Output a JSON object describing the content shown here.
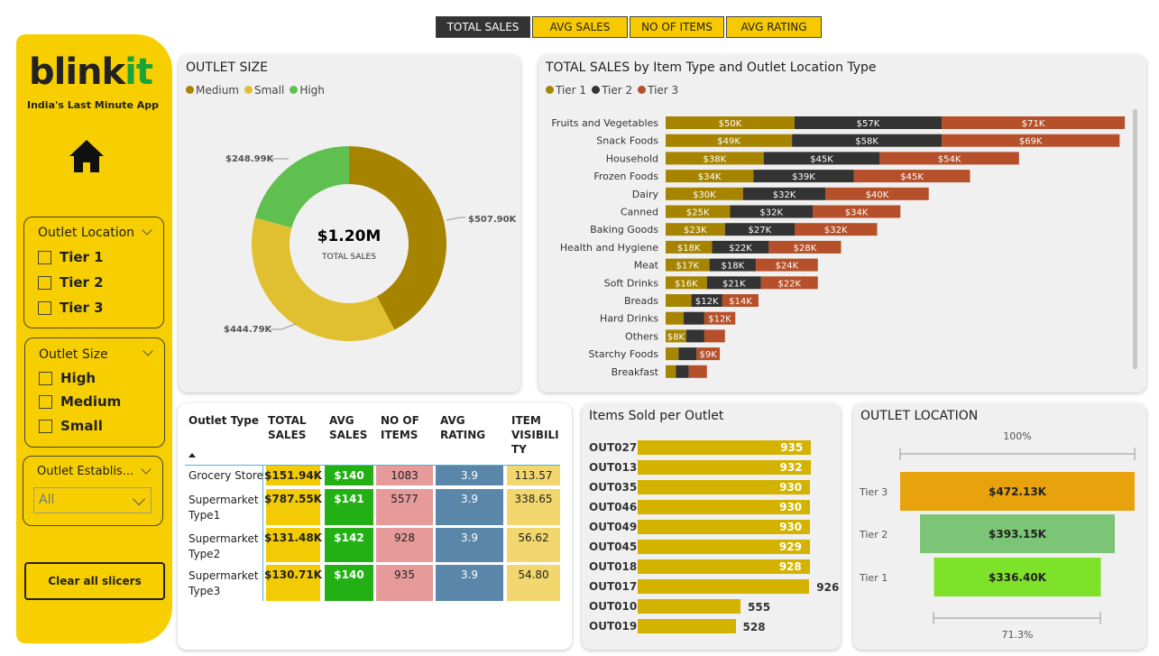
{
  "tabs": [
    {
      "label": "TOTAL SALES",
      "active": true
    },
    {
      "label": "AVG SALES",
      "active": false
    },
    {
      "label": "NO OF ITEMS",
      "active": false
    },
    {
      "label": "AVG RATING",
      "active": false
    }
  ],
  "sidebar": {
    "logo_part1": "blink",
    "logo_part2": "it",
    "tagline": "India's Last Minute App",
    "home_icon": "home-icon",
    "outlet_location": {
      "title": "Outlet Location",
      "options": [
        "Tier 1",
        "Tier 2",
        "Tier 3"
      ]
    },
    "outlet_size": {
      "title": "Outlet Size",
      "options": [
        "High",
        "Medium",
        "Small"
      ]
    },
    "outlet_establishment": {
      "title": "Outlet Establis...",
      "value": "All"
    },
    "clear_button": "Clear all slicers"
  },
  "outlet_size_chart": {
    "title": "OUTLET SIZE",
    "center_value": "$1.20M",
    "center_label": "TOTAL SALES",
    "legend": [
      "Medium",
      "Small",
      "High"
    ],
    "colors": {
      "Medium": "#A68400",
      "Small": "#E0C030",
      "High": "#5FBF4F"
    },
    "labels": [
      "$507.90K",
      "$444.79K",
      "$248.99K"
    ]
  },
  "item_type_chart": {
    "title": "TOTAL SALES by Item Type and Outlet Location Type",
    "legend": [
      "Tier 1",
      "Tier 2",
      "Tier 3"
    ],
    "colors": {
      "Tier 1": "#A68400",
      "Tier 2": "#333333",
      "Tier 3": "#B5502A"
    }
  },
  "chart_data": [
    {
      "type": "pie",
      "title": "OUTLET SIZE",
      "categories": [
        "Medium",
        "Small",
        "High"
      ],
      "values": [
        507.9,
        444.79,
        248.99
      ],
      "unit": "$K"
    },
    {
      "type": "bar",
      "orientation": "horizontal",
      "stacked": true,
      "title": "TOTAL SALES by Item Type and Outlet Location Type",
      "categories": [
        "Fruits and Vegetables",
        "Snack Foods",
        "Household",
        "Frozen Foods",
        "Dairy",
        "Canned",
        "Baking Goods",
        "Health and Hygiene",
        "Meat",
        "Soft Drinks",
        "Breads",
        "Hard Drinks",
        "Others",
        "Starchy Foods",
        "Breakfast"
      ],
      "series": [
        {
          "name": "Tier 1",
          "values": [
            50,
            49,
            38,
            34,
            30,
            25,
            23,
            18,
            17,
            16,
            10,
            7,
            8,
            5,
            4
          ],
          "labels": [
            "$50K",
            "$49K",
            "$38K",
            "$34K",
            "$30K",
            "$25K",
            "$23K",
            "$18K",
            "$17K",
            "$16K",
            "",
            "",
            "$8K",
            "",
            ""
          ]
        },
        {
          "name": "Tier 2",
          "values": [
            57,
            58,
            45,
            39,
            32,
            32,
            27,
            22,
            18,
            21,
            12,
            8,
            7,
            7,
            5
          ],
          "labels": [
            "$57K",
            "$58K",
            "$45K",
            "$39K",
            "$32K",
            "$32K",
            "$27K",
            "$22K",
            "$18K",
            "$21K",
            "$12K",
            "",
            "",
            "",
            ""
          ]
        },
        {
          "name": "Tier 3",
          "values": [
            71,
            69,
            54,
            45,
            40,
            34,
            32,
            28,
            24,
            22,
            14,
            12,
            8,
            9,
            7
          ],
          "labels": [
            "$71K",
            "$69K",
            "$54K",
            "$45K",
            "$40K",
            "$34K",
            "$32K",
            "$28K",
            "$24K",
            "$22K",
            "$14K",
            "$12K",
            "",
            "$9K",
            ""
          ]
        }
      ]
    },
    {
      "type": "bar",
      "orientation": "horizontal",
      "title": "Items Sold per Outlet",
      "categories": [
        "OUT027",
        "OUT013",
        "OUT035",
        "OUT046",
        "OUT049",
        "OUT045",
        "OUT018",
        "OUT017",
        "OUT010",
        "OUT019"
      ],
      "values": [
        935,
        932,
        930,
        930,
        930,
        929,
        928,
        926,
        555,
        528
      ]
    },
    {
      "type": "bar",
      "orientation": "funnel",
      "title": "OUTLET LOCATION",
      "categories": [
        "Tier 3",
        "Tier 2",
        "Tier 1"
      ],
      "values": [
        472.13,
        393.15,
        336.4
      ],
      "labels": [
        "$472.13K",
        "$393.15K",
        "$336.40K"
      ],
      "top_percent": "100%",
      "bottom_percent": "71.3%"
    }
  ],
  "outlet_table": {
    "headers": [
      [
        "Outlet Type"
      ],
      [
        "TOTAL",
        "SALES"
      ],
      [
        "AVG",
        "SALES"
      ],
      [
        "NO OF",
        "ITEMS"
      ],
      [
        "AVG",
        "RATING"
      ],
      [
        "ITEM",
        "VISIBILI",
        "TY"
      ]
    ],
    "rows": [
      {
        "type": [
          "Grocery Store"
        ],
        "total": "$151.94K",
        "avg": "$140",
        "items": "1083",
        "rating": "3.9",
        "vis": "113.57"
      },
      {
        "type": [
          "Supermarket",
          "Type1"
        ],
        "total": "$787.55K",
        "avg": "$141",
        "items": "5577",
        "rating": "3.9",
        "vis": "338.65"
      },
      {
        "type": [
          "Supermarket",
          "Type2"
        ],
        "total": "$131.48K",
        "avg": "$142",
        "items": "928",
        "rating": "3.9",
        "vis": "56.62"
      },
      {
        "type": [
          "Supermarket",
          "Type3"
        ],
        "total": "$130.71K",
        "avg": "$140",
        "items": "935",
        "rating": "3.9",
        "vis": "54.80"
      }
    ]
  },
  "items_sold_title": "Items Sold per Outlet",
  "outlet_location_title": "OUTLET LOCATION"
}
